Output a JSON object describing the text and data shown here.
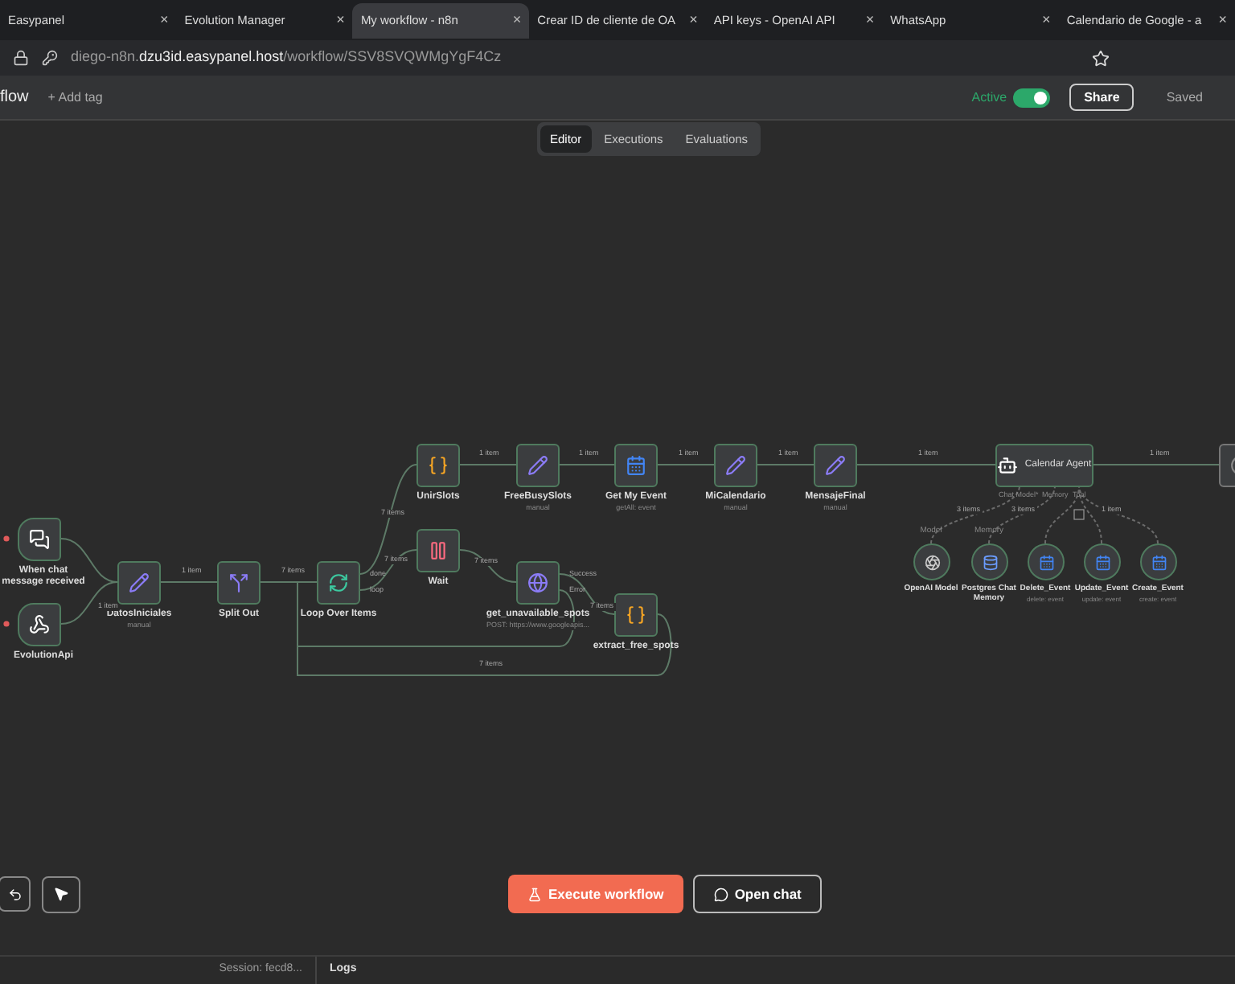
{
  "browser_tabs": [
    {
      "title": "Easypanel",
      "selected": false
    },
    {
      "title": "Evolution Manager",
      "selected": false
    },
    {
      "title": "My workflow - n8n",
      "selected": true
    },
    {
      "title": "Crear ID de cliente de OA",
      "selected": false
    },
    {
      "title": "API keys - OpenAI API",
      "selected": false
    },
    {
      "title": "WhatsApp",
      "selected": false
    },
    {
      "title": "Calendario de Google - a",
      "selected": false
    }
  ],
  "tab_close": "×",
  "address": "diego-n8n.**dzu3id.easypanel.host**/workflow/SSV8SVQWMgYgF4Cz",
  "header": {
    "title": "flow",
    "add_tag": "+ Add tag",
    "active_label": "Active",
    "active": true,
    "share": "Share",
    "saved": "Saved"
  },
  "view_tabs": [
    {
      "label": "Editor",
      "selected": true
    },
    {
      "label": "Executions",
      "selected": false
    },
    {
      "label": "Evaluations",
      "selected": false
    }
  ],
  "nodes": [
    {
      "kind": "trigger",
      "label": "When chat message received"
    },
    {
      "kind": "trigger",
      "label": "EvolutionApi"
    },
    {
      "kind": "node",
      "label": "DatosIniciales",
      "subtitle": "manual"
    },
    {
      "kind": "node",
      "label": "Split Out"
    },
    {
      "kind": "node",
      "label": "Loop Over Items",
      "outputs": [
        "done",
        "loop"
      ]
    },
    {
      "kind": "node",
      "label": "UnirSlots"
    },
    {
      "kind": "node",
      "label": "FreeBusySlots",
      "subtitle": "manual"
    },
    {
      "kind": "node",
      "label": "Get My Event",
      "subtitle": "getAll: event"
    },
    {
      "kind": "node",
      "label": "Wait"
    },
    {
      "kind": "node",
      "label": "get_unavailable_spots",
      "subtitle": "POST: https://www.googleapis...",
      "outputs": [
        "Success",
        "Error"
      ]
    },
    {
      "kind": "node",
      "label": "extract_free_spots"
    },
    {
      "kind": "node",
      "label": "MiCalendario",
      "subtitle": "manual"
    },
    {
      "kind": "node",
      "label": "MensajeFinal",
      "subtitle": "manual"
    },
    {
      "kind": "agent",
      "label": "Calendar Agent",
      "inputs": [
        "Chat Model*",
        "Memory",
        "Tool"
      ]
    },
    {
      "kind": "tool",
      "label": "OpenAI Model",
      "role": "Model"
    },
    {
      "kind": "tool",
      "label": "Postgres Chat Memory",
      "role": "Memory"
    },
    {
      "kind": "tool",
      "label": "Delete_Event",
      "subtitle": "delete: event"
    },
    {
      "kind": "tool",
      "label": "Update_Event",
      "subtitle": "update: event"
    },
    {
      "kind": "tool",
      "label": "Create_Event",
      "subtitle": "create: event"
    },
    {
      "kind": "partial"
    }
  ],
  "edge_labels": [
    "1 item",
    "1 item",
    "7 items",
    "7 items",
    "7 items",
    "1 item",
    "1 item",
    "1 item",
    "1 item",
    "1 item",
    "1 item",
    "7 items",
    "7 items",
    "7 items",
    "3 items",
    "3 items",
    "1 item"
  ],
  "buttons": {
    "execute": "Execute workflow",
    "open_chat": "Open chat"
  },
  "status_bar": {
    "session": "Session: fecd8...",
    "logs": "Logs"
  }
}
